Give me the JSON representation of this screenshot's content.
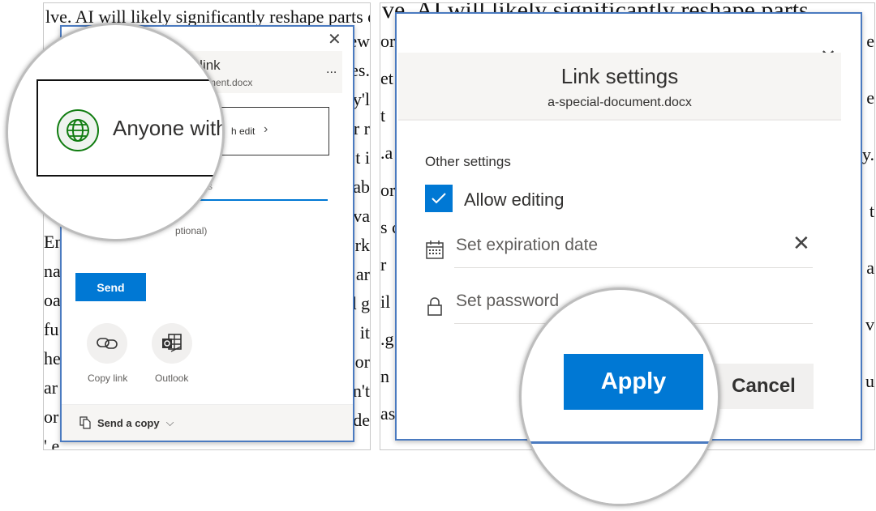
{
  "left": {
    "doc_fragments": {
      "top_line": "lve. AI will likely significantly reshape parts o",
      "right_edge": [
        "ew",
        "es.",
        "y'l",
        "r r",
        "t i",
        "ab",
        "va",
        "rk",
        "ar",
        "d g",
        "it",
        "or",
        "n't",
        "de"
      ],
      "left_edge": [
        "En",
        "nas",
        "oa",
        " fu",
        "he",
        "ar",
        "or",
        "' e"
      ]
    },
    "dialog": {
      "title_partial": "d link",
      "filename_partial": "ment.docx",
      "more_label": "...",
      "permission_partial": "h edit",
      "field_partial": "s",
      "message_partial": "ptional)",
      "send_label": "Send",
      "share_options": [
        {
          "label": "Copy link",
          "icon": "link-icon"
        },
        {
          "label": "Outlook",
          "icon": "outlook-icon"
        }
      ],
      "send_copy_label": "Send a copy"
    },
    "magnifier": {
      "permission_label": "Anyone with",
      "icon": "globe-icon",
      "icon_color": "#107c10"
    }
  },
  "right": {
    "doc_fragments": {
      "top_line": "ve. AI will likely significantly reshape parts",
      "left_edge": [
        "or",
        "et",
        " t",
        ".a",
        "or",
        "s c",
        "r",
        "il",
        ".g",
        "n",
        "as"
      ],
      "right_edge": [
        "e",
        "e",
        "y.",
        "t",
        "a",
        "v",
        "u"
      ]
    },
    "dialog": {
      "title": "Link settings",
      "filename": "a-special-document.docx",
      "section_label": "Other settings",
      "allow_editing": {
        "label": "Allow editing",
        "checked": true
      },
      "expiration_placeholder": "Set expiration date",
      "password_placeholder": "Set password",
      "apply_label": "Apply",
      "cancel_label": "Cancel"
    }
  },
  "colors": {
    "accent": "#0078d4",
    "dialog_border": "#4a7ac0",
    "band": "#f6f5f3"
  }
}
